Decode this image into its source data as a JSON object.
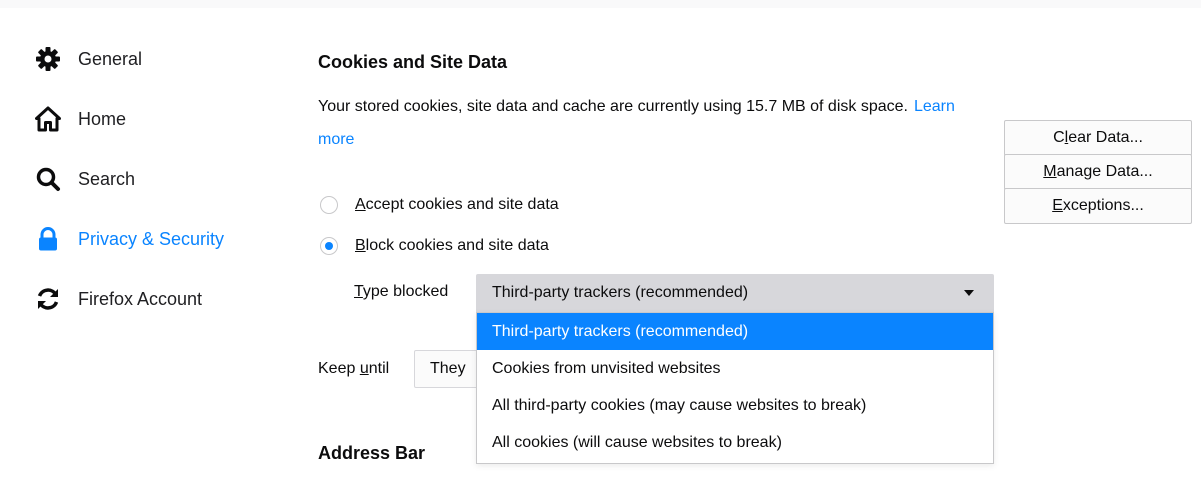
{
  "sidebar": {
    "items": [
      {
        "icon": "gear-icon",
        "label": "General",
        "selected": false
      },
      {
        "icon": "home-icon",
        "label": "Home",
        "selected": false
      },
      {
        "icon": "search-icon",
        "label": "Search",
        "selected": false
      },
      {
        "icon": "lock-icon",
        "label": "Privacy & Security",
        "selected": true
      },
      {
        "icon": "sync-icon",
        "label": "Firefox Account",
        "selected": false
      }
    ]
  },
  "cookies": {
    "heading": "Cookies and Site Data",
    "description": "Your stored cookies, site data and cache are currently using 15.7 MB of disk space.",
    "learn_more": "Learn more",
    "buttons": {
      "clear_pre": "C",
      "clear_access": "l",
      "clear_post": "ear Data...",
      "manage_access": "M",
      "manage_post": "anage Data...",
      "exceptions_access": "E",
      "exceptions_post": "xceptions..."
    },
    "accept": {
      "access": "A",
      "rest": "ccept cookies and site data",
      "checked": false
    },
    "block": {
      "access": "B",
      "rest": "lock cookies and site data",
      "checked": true
    },
    "type_blocked": {
      "access": "T",
      "rest": "ype blocked"
    },
    "selected_type": "Third-party trackers (recommended)",
    "options": [
      "Third-party trackers (recommended)",
      "Cookies from unvisited websites",
      "All third-party cookies (may cause websites to break)",
      "All cookies (will cause websites to break)"
    ],
    "keep_until": {
      "pre": "Keep ",
      "access": "u",
      "post": "ntil",
      "value": "They"
    }
  },
  "address_bar": {
    "heading": "Address Bar"
  },
  "colors": {
    "accent": "#0a84ff",
    "select_bg": "#d7d7db",
    "text": "#0c0c0d"
  }
}
